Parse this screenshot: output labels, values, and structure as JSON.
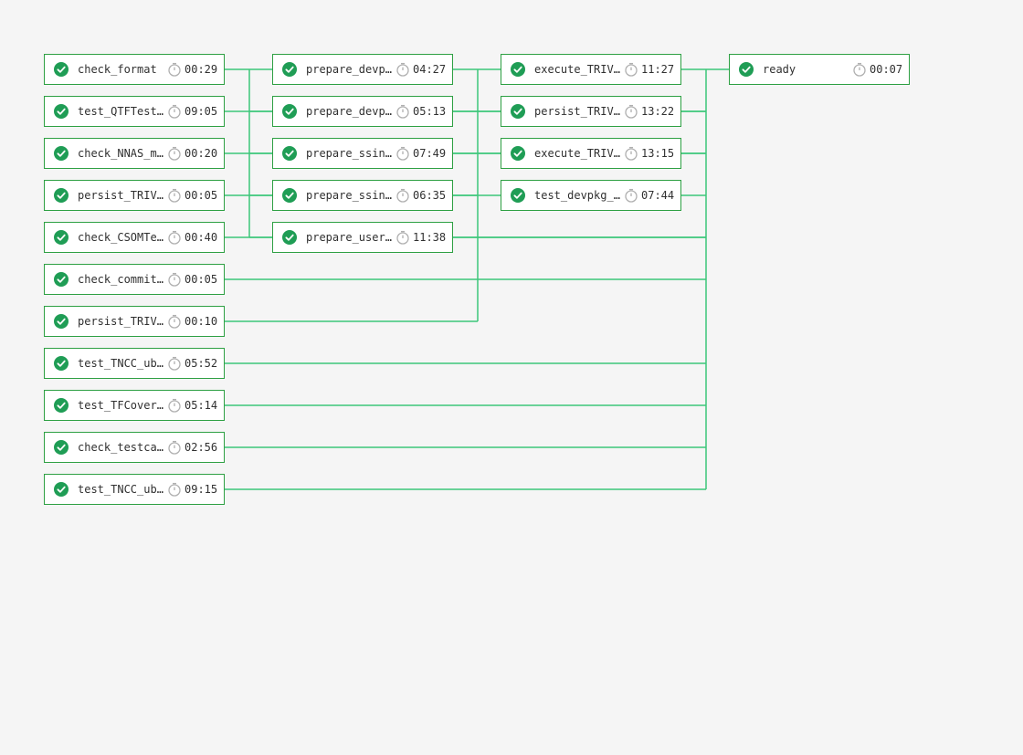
{
  "colors": {
    "success": "#1f9d55",
    "connector": "#3cc77a",
    "border": "#2ea043",
    "timer": "#b0b0b0"
  },
  "icons": {
    "status": "check-circle-icon",
    "timer": "stopwatch-icon"
  },
  "stages": [
    {
      "jobs": [
        {
          "name": "check_format",
          "duration": "00:29"
        },
        {
          "name": "test_QTFTest…",
          "duration": "09:05"
        },
        {
          "name": "check_NNAS_m…",
          "duration": "00:20"
        },
        {
          "name": "persist_TRIV…",
          "duration": "00:05"
        },
        {
          "name": "check_CSOMTe…",
          "duration": "00:40"
        },
        {
          "name": "check_commit…",
          "duration": "00:05"
        },
        {
          "name": "persist_TRIV…",
          "duration": "00:10"
        },
        {
          "name": "test_TNCC_ub…",
          "duration": "05:52"
        },
        {
          "name": "test_TFCover…",
          "duration": "05:14"
        },
        {
          "name": "check_testca…",
          "duration": "02:56"
        },
        {
          "name": "test_TNCC_ub…",
          "duration": "09:15"
        }
      ]
    },
    {
      "jobs": [
        {
          "name": "prepare_devp…",
          "duration": "04:27"
        },
        {
          "name": "prepare_devp…",
          "duration": "05:13"
        },
        {
          "name": "prepare_ssin…",
          "duration": "07:49"
        },
        {
          "name": "prepare_ssin…",
          "duration": "06:35"
        },
        {
          "name": "prepare_user…",
          "duration": "11:38"
        }
      ]
    },
    {
      "jobs": [
        {
          "name": "execute_TRIV…",
          "duration": "11:27"
        },
        {
          "name": "persist_TRIV…",
          "duration": "13:22"
        },
        {
          "name": "execute_TRIV…",
          "duration": "13:15"
        },
        {
          "name": "test_devpkg_…",
          "duration": "07:44"
        }
      ]
    },
    {
      "jobs": [
        {
          "name": "ready",
          "duration": "00:07"
        }
      ]
    }
  ]
}
